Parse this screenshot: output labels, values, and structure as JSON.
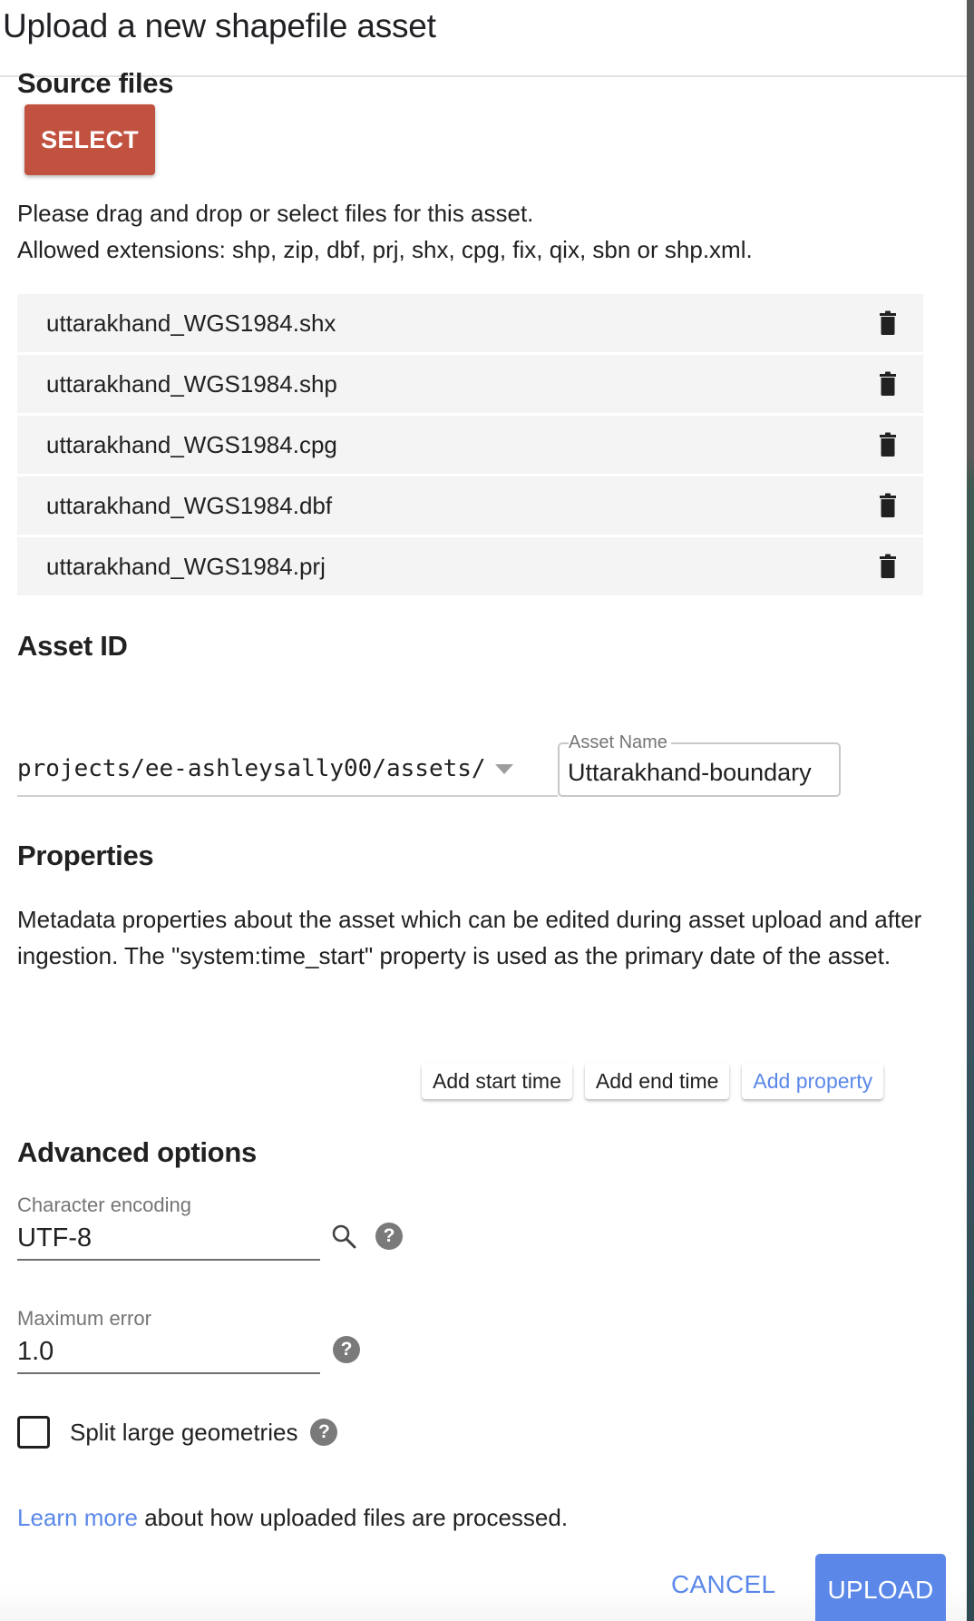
{
  "dialog": {
    "title": "Upload a new shapefile asset"
  },
  "source_files": {
    "title": "Source files",
    "select_label": "SELECT",
    "help_line1": "Please drag and drop or select files for this asset.",
    "help_line2": "Allowed extensions: shp, zip, dbf, prj, shx, cpg, fix, qix, sbn or shp.xml.",
    "files": [
      {
        "name": "uttarakhand_WGS1984.shx",
        "icon": "trash-icon"
      },
      {
        "name": "uttarakhand_WGS1984.shp",
        "icon": "trash-icon"
      },
      {
        "name": "uttarakhand_WGS1984.cpg",
        "icon": "trash-icon"
      },
      {
        "name": "uttarakhand_WGS1984.dbf",
        "icon": "trash-icon"
      },
      {
        "name": "uttarakhand_WGS1984.prj",
        "icon": "trash-icon"
      }
    ]
  },
  "asset_id": {
    "title": "Asset ID",
    "path": "projects/ee-ashleysally00/assets/",
    "name_label": "Asset Name",
    "name_value": "Uttarakhand-boundary"
  },
  "properties": {
    "title": "Properties",
    "description": "Metadata properties about the asset which can be edited during asset upload and after ingestion. The \"system:time_start\" property is used as the primary date of the asset.",
    "buttons": {
      "start_time": "Add start time",
      "end_time": "Add end time",
      "add_property": "Add property"
    }
  },
  "advanced": {
    "title": "Advanced options",
    "encoding_label": "Character encoding",
    "encoding_value": "UTF-8",
    "max_error_label": "Maximum error",
    "max_error_value": "1.0",
    "split_label": "Split large geometries",
    "split_checked": false,
    "help_glyph": "?"
  },
  "footer": {
    "learn_more_link": "Learn more",
    "learn_more_text": " about how uploaded files are processed.",
    "cancel_label": "CANCEL",
    "upload_label": "UPLOAD"
  },
  "colors": {
    "select_button": "#c1523f",
    "accent_blue": "#5b88e8",
    "file_row_bg": "#f4f4f4"
  }
}
